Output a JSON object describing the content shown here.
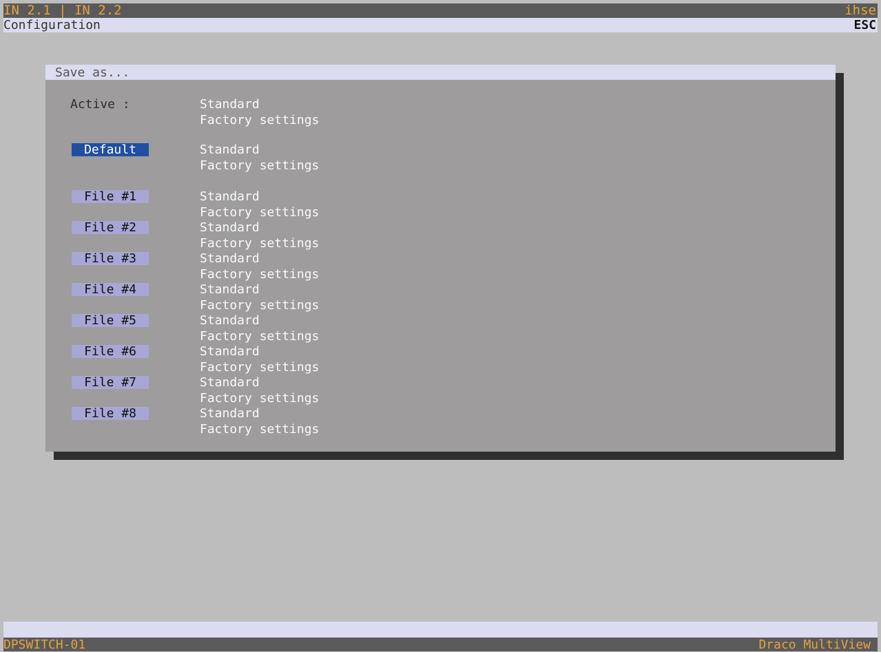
{
  "header": {
    "title": "IN 2.1 | IN 2.2",
    "brand": "ihse"
  },
  "subheader": {
    "title": "Configuration",
    "esc_label": "ESC"
  },
  "dialog": {
    "title": "Save as...",
    "active": {
      "label": "Active :",
      "line1": "Standard",
      "line2": "Factory settings"
    },
    "default": {
      "label": "Default",
      "line1": "Standard",
      "line2": "Factory settings"
    },
    "files": [
      {
        "label": "File #1",
        "line1": "Standard",
        "line2": "Factory settings"
      },
      {
        "label": "File #2",
        "line1": "Standard",
        "line2": "Factory settings"
      },
      {
        "label": "File #3",
        "line1": "Standard",
        "line2": "Factory settings"
      },
      {
        "label": "File #4",
        "line1": "Standard",
        "line2": "Factory settings"
      },
      {
        "label": "File #5",
        "line1": "Standard",
        "line2": "Factory settings"
      },
      {
        "label": "File #6",
        "line1": "Standard",
        "line2": "Factory settings"
      },
      {
        "label": "File #7",
        "line1": "Standard",
        "line2": "Factory settings"
      },
      {
        "label": "File #8",
        "line1": "Standard",
        "line2": "Factory settings"
      }
    ]
  },
  "footer": {
    "device_name": "DPSWITCH-01",
    "product": "Draco MultiView"
  },
  "colors": {
    "header_bg": "#5a5a5a",
    "header_text": "#e8a23a",
    "light_bar": "#dcdcf0",
    "dialog_bg": "#9e9c9c",
    "button_bg": "#a8a6d4",
    "button_selected": "#1f4fa3"
  }
}
